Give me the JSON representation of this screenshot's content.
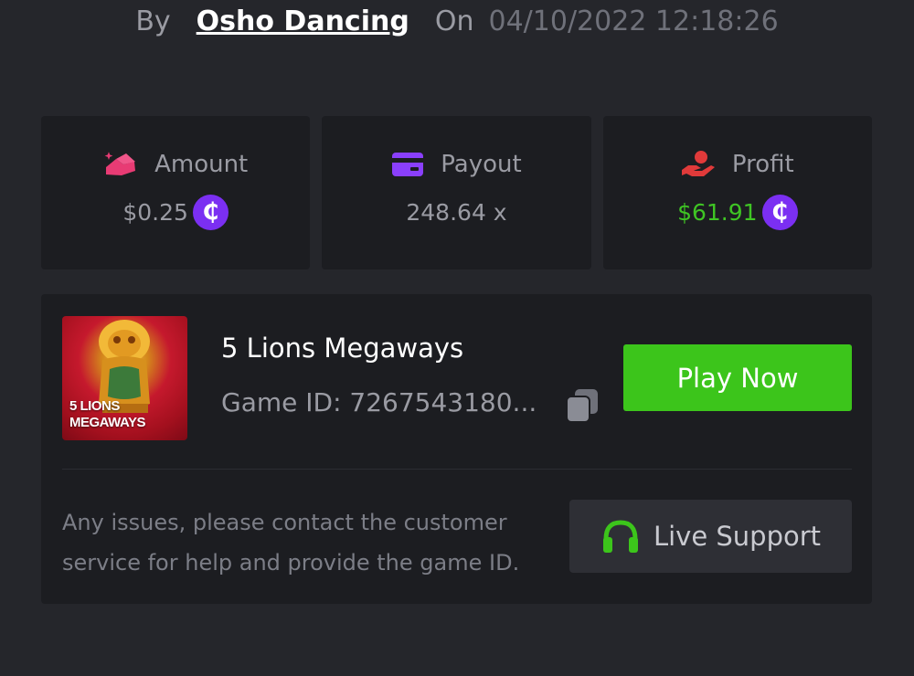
{
  "header": {
    "by_label": "By",
    "username": "Osho Dancing",
    "on_label": "On",
    "datetime": "04/10/2022 12:18:26"
  },
  "stats": {
    "amount": {
      "label": "Amount",
      "value": "$0.25",
      "icon": "amount-icon",
      "color": "#e83b74"
    },
    "payout": {
      "label": "Payout",
      "value": "248.64 x",
      "icon": "card-icon",
      "color": "#8a3ffc"
    },
    "profit": {
      "label": "Profit",
      "value": "$61.91",
      "icon": "hand-coin-icon",
      "color": "#e03a3a",
      "value_color": "#3fc524"
    },
    "coin_symbol": "₵",
    "coin_color": "#7b2ff2"
  },
  "game": {
    "title": "5 Lions Megaways",
    "id_text": "Game ID: 7267543180...",
    "thumb_line1": "5 LIONS",
    "thumb_line2": "MEGAWAYS",
    "play_label": "Play Now",
    "play_color": "#3cc51b"
  },
  "help": {
    "text": "Any issues, please contact the customer service for help and provide the game ID.",
    "support_label": "Live Support",
    "support_icon": "headset-icon"
  }
}
